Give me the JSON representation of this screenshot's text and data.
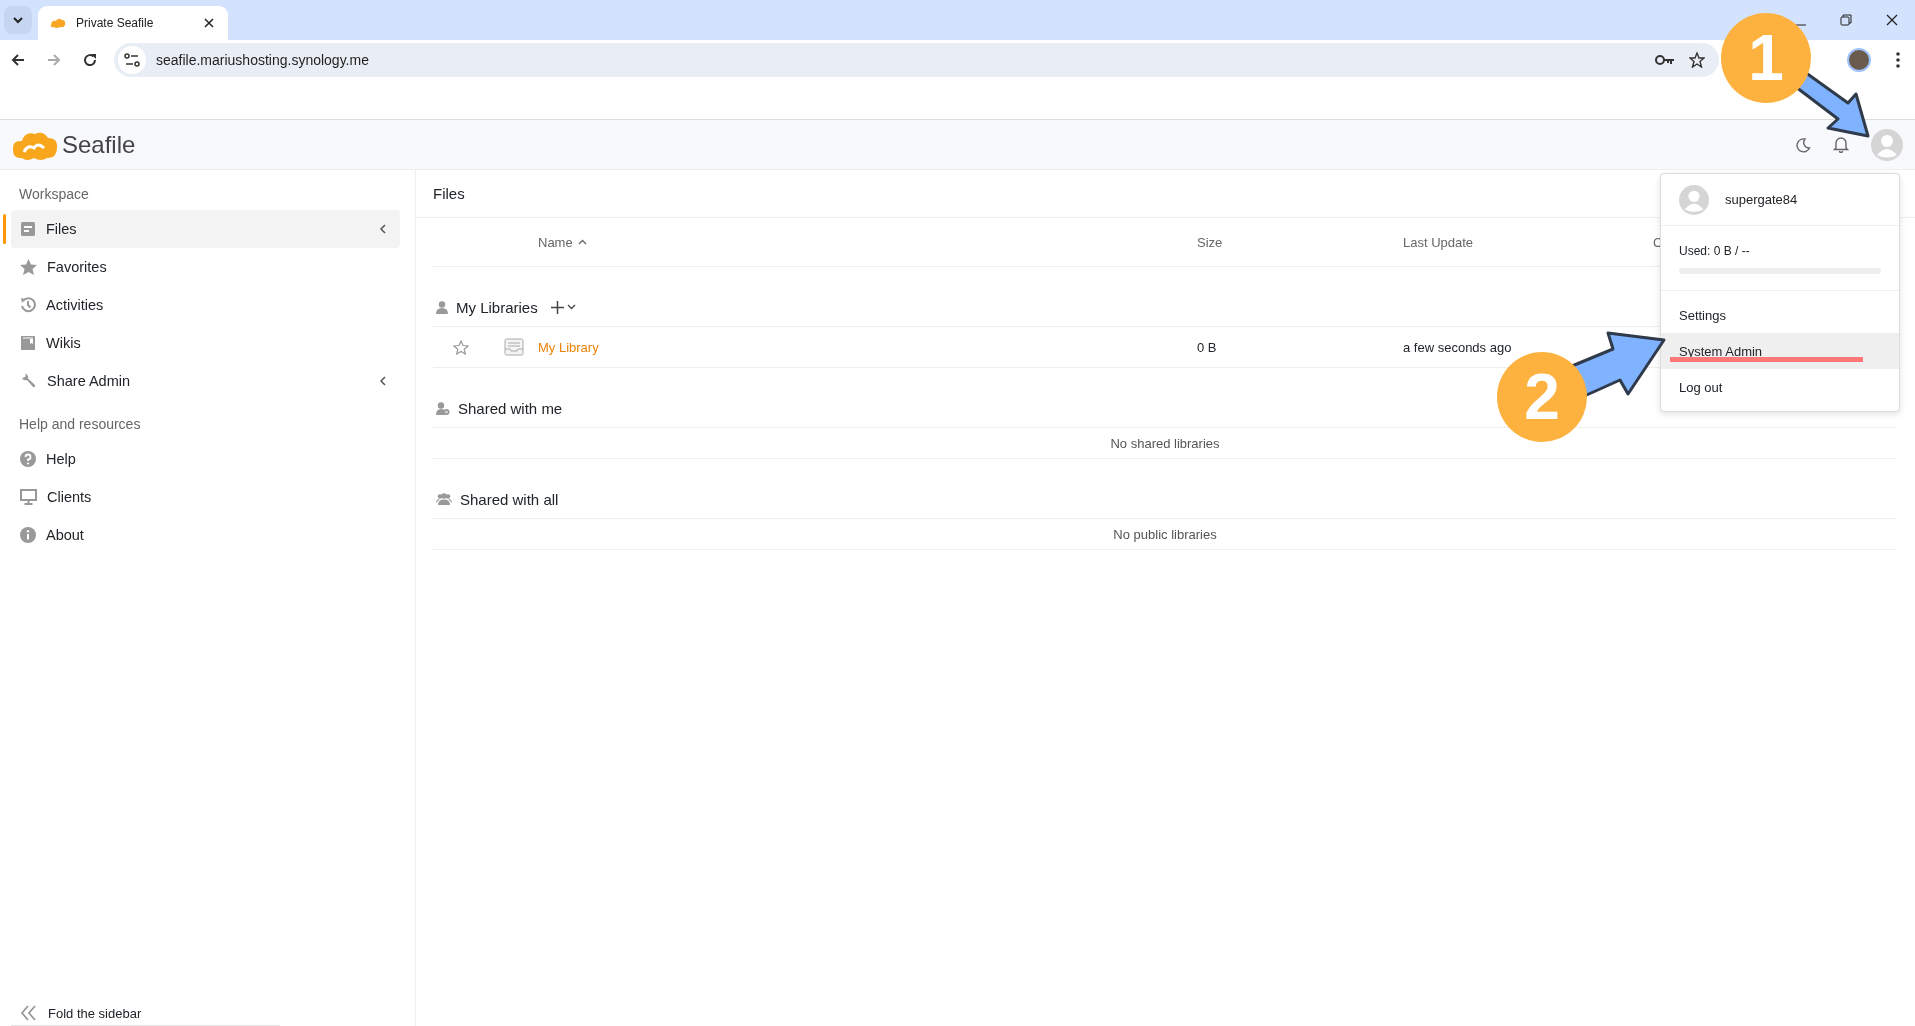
{
  "browser": {
    "tab_title": "Private Seafile",
    "url": "seafile.mariushosting.synology.me",
    "forward_enabled": false
  },
  "app": {
    "logo_text": "Seafile"
  },
  "sidebar": {
    "sections": [
      {
        "heading": "Workspace",
        "items": [
          {
            "label": "Files",
            "selected": true,
            "has_submenu": true
          },
          {
            "label": "Favorites",
            "selected": false,
            "has_submenu": false
          },
          {
            "label": "Activities",
            "selected": false,
            "has_submenu": false
          },
          {
            "label": "Wikis",
            "selected": false,
            "has_submenu": false
          },
          {
            "label": "Share Admin",
            "selected": false,
            "has_submenu": true
          }
        ]
      },
      {
        "heading": "Help and resources",
        "items": [
          {
            "label": "Help",
            "selected": false,
            "has_submenu": false
          },
          {
            "label": "Clients",
            "selected": false,
            "has_submenu": false
          },
          {
            "label": "About",
            "selected": false,
            "has_submenu": false
          }
        ]
      }
    ],
    "fold_label": "Fold the sidebar"
  },
  "main": {
    "title": "Files",
    "columns": [
      "Name",
      "Size",
      "Last Update",
      "C"
    ],
    "groups": [
      {
        "title": "My Libraries",
        "add_menu": true,
        "rows": [
          {
            "starred": false,
            "name": "My Library",
            "size": "0 B",
            "last_update": "a few seconds ago"
          }
        ]
      },
      {
        "title": "Shared with me",
        "add_menu": false,
        "empty_text": "No shared libraries"
      },
      {
        "title": "Shared with all",
        "add_menu": false,
        "empty_text": "No public libraries"
      }
    ]
  },
  "user_menu": {
    "username": "supergate84",
    "usage": "Used: 0 B / --",
    "level": 0,
    "items": [
      {
        "label": "Settings",
        "selected": false,
        "underlined": false
      },
      {
        "label": "System Admin",
        "selected": true,
        "underlined": true
      },
      {
        "label": "Log out",
        "selected": false,
        "underlined": false
      }
    ]
  },
  "annotations": [
    {
      "number": "1"
    },
    {
      "number": "2"
    }
  ]
}
